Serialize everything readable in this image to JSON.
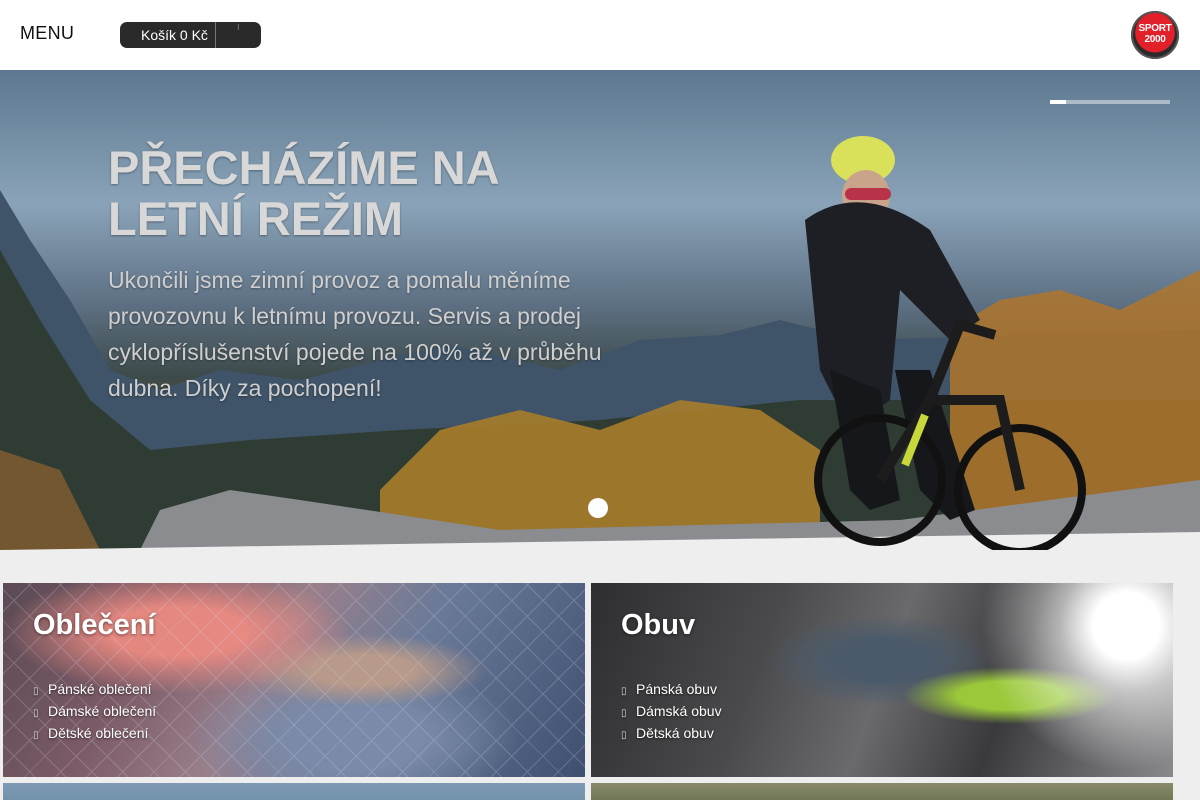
{
  "header": {
    "menu_label": "MENU",
    "cart_label": "Košík 0 Kč",
    "cart_toggle_glyph": "⁝",
    "logo_top": "SPORT",
    "logo_bottom": "2000"
  },
  "hero": {
    "title_line1": "PŘECHÁZÍME NA",
    "title_line2": "LETNÍ REŽIM",
    "text": "Ukončili jsme zimní provoz a pomalu měníme provozovnu k letnímu provozu. Servis a prodej cyklopříslušenství pojede na 100% až v průběhu dubna. Díky za pochopení!",
    "slide_progress": 0.13
  },
  "categories": [
    {
      "title": "Oblečení",
      "items": [
        "Pánské oblečení",
        "Dámské oblečení",
        "Dětské oblečení"
      ]
    },
    {
      "title": "Obuv",
      "items": [
        "Pánská obuv",
        "Dámská obuv",
        "Dětská obuv"
      ]
    }
  ],
  "list_bullet_glyph": "▯",
  "colors": {
    "header_bg": "#ffffff",
    "cart_bg": "#2a2a2a",
    "logo_red": "#e2202a",
    "page_bg": "#eeeeee"
  }
}
